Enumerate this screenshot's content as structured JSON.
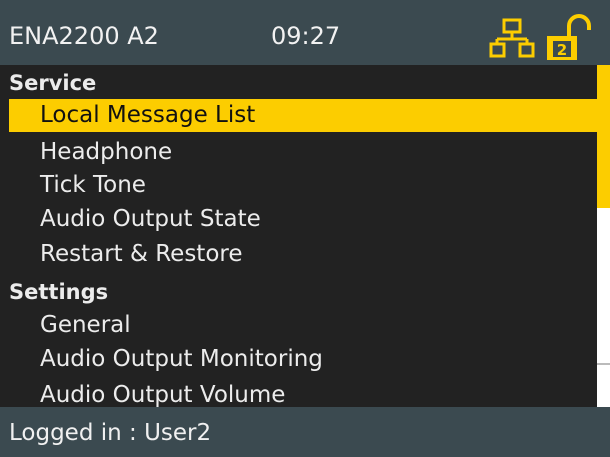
{
  "header": {
    "device_name": "ENA2200 A2",
    "time": "09:27",
    "network_icon": "network-icon",
    "lock_icon": "unlocked-icon",
    "lock_level": "2"
  },
  "menu": {
    "sections": [
      {
        "label": "Service",
        "items": [
          {
            "label": "Local Message List",
            "selected": true
          },
          {
            "label": "Headphone"
          },
          {
            "label": "Tick Tone"
          },
          {
            "label": "Audio Output State"
          },
          {
            "label": "Restart & Restore"
          }
        ]
      },
      {
        "label": "Settings",
        "items": [
          {
            "label": "General"
          },
          {
            "label": "Audio Output Monitoring"
          },
          {
            "label": "Audio Output Volume"
          }
        ]
      }
    ]
  },
  "footer": {
    "status": "Logged in : User2"
  },
  "colors": {
    "header_bg": "#3b4a50",
    "accent": "#fccd00",
    "background": "#222222"
  }
}
